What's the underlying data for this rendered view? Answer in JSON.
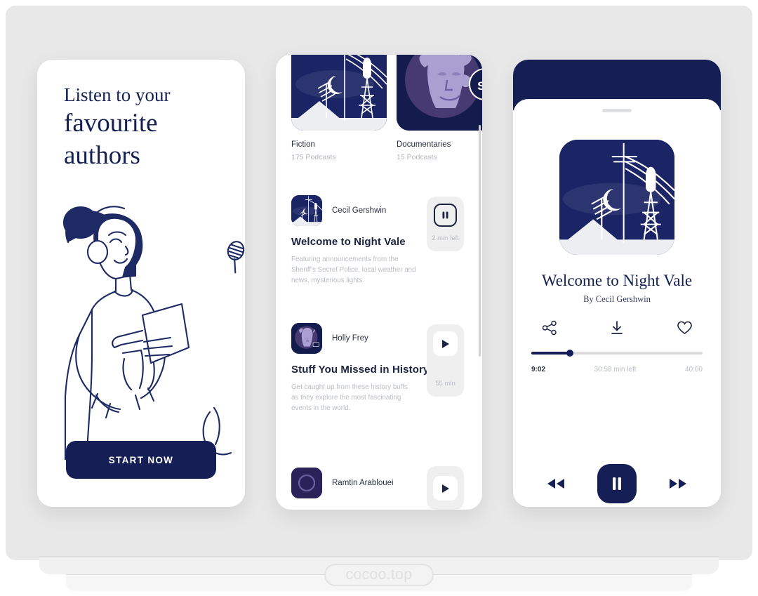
{
  "watermark": "cocoo.top",
  "onboarding": {
    "headline_line_1": "Listen to your",
    "headline_line_2": "favourite",
    "headline_line_3": "authors",
    "cta_label": "START NOW"
  },
  "browse": {
    "categories": [
      {
        "name": "Fiction",
        "count": "175 Podcasts",
        "art": "night-vale"
      },
      {
        "name": "Documentaries",
        "count": "15 Podcasts",
        "art": "portrait"
      }
    ],
    "episodes": [
      {
        "author": "Cecil Gershwin",
        "title": "Welcome to Night Vale",
        "description": "Featuring announcements from the Sheriff's Secret Police, local weather and news, mysterious lights.",
        "duration_label": "2 min left",
        "state": "playing",
        "icon": "pause-icon",
        "art": "night-vale"
      },
      {
        "author": "Holly Frey",
        "title": "Stuff You Missed in History",
        "description": "Get caught up from these history buffs as they explore the most fascinating events in the world.",
        "duration_label": "55 min",
        "state": "paused",
        "icon": "play-icon",
        "art": "portrait"
      },
      {
        "author": "Ramtin Arablouei",
        "title": "",
        "description": "",
        "duration_label": "",
        "state": "paused",
        "icon": "play-icon",
        "art": "circle"
      }
    ]
  },
  "player": {
    "title": "Welcome to Night Vale",
    "byline": "By Cecil Gershwin",
    "actions": [
      {
        "name": "share-icon",
        "label": "Share"
      },
      {
        "name": "download-icon",
        "label": "Download"
      },
      {
        "name": "favorite-icon",
        "label": "Favourite"
      }
    ],
    "progress_percent": 22.5,
    "time_current": "9:02",
    "time_remaining": "30:58 min left",
    "time_total": "40:00",
    "transport": {
      "rewind": "rewind-icon",
      "main": "pause-icon",
      "forward": "fast-forward-icon"
    }
  },
  "colors": {
    "navy": "#151f55",
    "canvas": "#e8e8e8",
    "muted": "#b9bcc4"
  }
}
